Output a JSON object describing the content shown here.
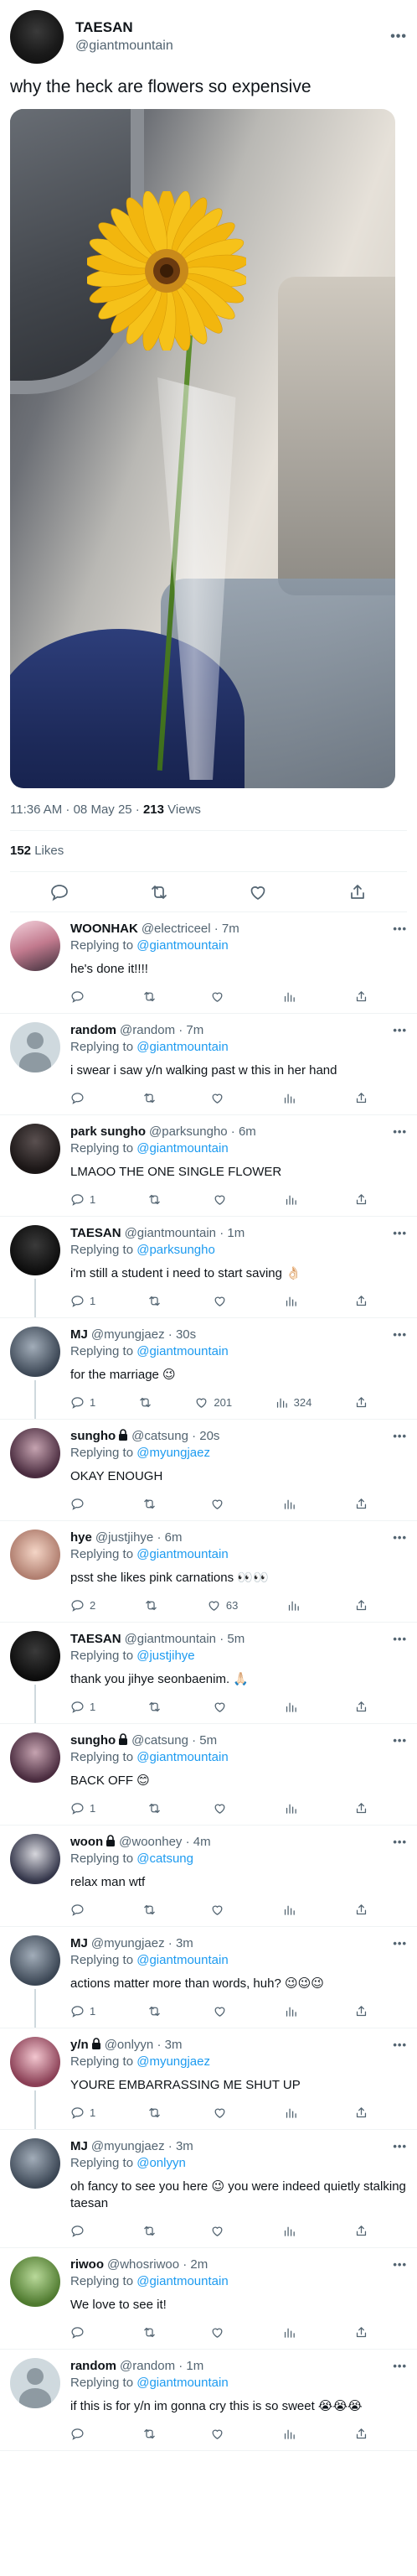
{
  "main": {
    "name": "TAESAN",
    "handle": "@giantmountain",
    "text": "why the heck are flowers so expensive",
    "time": "11:36 AM · 08 May 25 · ",
    "views_count": "213",
    "views_label": " Views",
    "likes_count": "152",
    "likes_label": " Likes"
  },
  "replies": [
    {
      "name": "WOONHAK",
      "handle": "@electriceel · 7m",
      "to": "@giantmountain",
      "text": "he's done it!!!!",
      "comments": "",
      "likes": "",
      "views": ""
    },
    {
      "name": "random",
      "handle": "@random · 7m",
      "to": "@giantmountain",
      "text": "i swear i saw y/n walking past w this in her hand",
      "comments": "",
      "likes": "",
      "views": ""
    },
    {
      "name": "park sungho",
      "handle": "@parksungho · 6m",
      "to": "@giantmountain",
      "text": "LMAOO THE ONE SINGLE FLOWER",
      "comments": "1",
      "likes": "",
      "views": ""
    },
    {
      "name": "TAESAN",
      "handle": "@giantmountain · 1m",
      "to": "@parksungho",
      "text": "i'm still a student i need to start saving 👌🏻",
      "comments": "1",
      "likes": "",
      "views": ""
    },
    {
      "name": "MJ",
      "handle": "@myungjaez · 30s",
      "to": "@giantmountain",
      "text": "for the marriage 😉",
      "comments": "1",
      "likes": "201",
      "views": "324"
    },
    {
      "name": "sungho",
      "handle": "@catsung · 20s",
      "to": "@myungjaez",
      "text": "OKAY ENOUGH",
      "comments": "",
      "likes": "",
      "views": ""
    },
    {
      "name": "hye",
      "handle": "@justjihye · 6m",
      "to": "@giantmountain",
      "text": "psst she likes pink carnations 👀👀",
      "comments": "2",
      "likes": "63",
      "views": ""
    },
    {
      "name": "TAESAN",
      "handle": "@giantmountain · 5m",
      "to": "@justjihye",
      "text": "thank you jihye seonbaenim. 🙏🏻",
      "comments": "1",
      "likes": "",
      "views": ""
    },
    {
      "name": "sungho",
      "handle": "@catsung · 5m",
      "to": "@giantmountain",
      "text": "BACK OFF 😊",
      "comments": "1",
      "likes": "",
      "views": ""
    },
    {
      "name": "woon",
      "handle": "@woonhey · 4m",
      "to": "@catsung",
      "text": "relax man wtf",
      "comments": "",
      "likes": "",
      "views": ""
    },
    {
      "name": "MJ",
      "handle": "@myungjaez · 3m",
      "to": "@giantmountain",
      "text": "actions matter more than words, huh? 😉😉😉",
      "comments": "1",
      "likes": "",
      "views": ""
    },
    {
      "name": "y/n",
      "handle": "@onlyyn · 3m",
      "to": "@myungjaez",
      "text": "YOURE EMBARRASSING ME SHUT UP",
      "comments": "1",
      "likes": "",
      "views": ""
    },
    {
      "name": "MJ",
      "handle": "@myungjaez · 3m",
      "to": "@onlyyn",
      "text": "oh fancy to see you here 😉 you were indeed quietly stalking taesan",
      "comments": "",
      "likes": "",
      "views": ""
    },
    {
      "name": "riwoo",
      "handle": "@whosriwoo · 2m",
      "to": "@giantmountain",
      "text": "We love to see it!",
      "comments": "",
      "likes": "",
      "views": ""
    },
    {
      "name": "random",
      "handle": "@random · 1m",
      "to": "@giantmountain",
      "text": "if this is for y/n im gonna cry this is so sweet 😭😭😭",
      "comments": "",
      "likes": "",
      "views": ""
    }
  ],
  "replying_label": "Replying to ",
  "colors": {
    "accent": "#1d9bf0",
    "muted": "#536471",
    "divider": "#eff3f4"
  }
}
